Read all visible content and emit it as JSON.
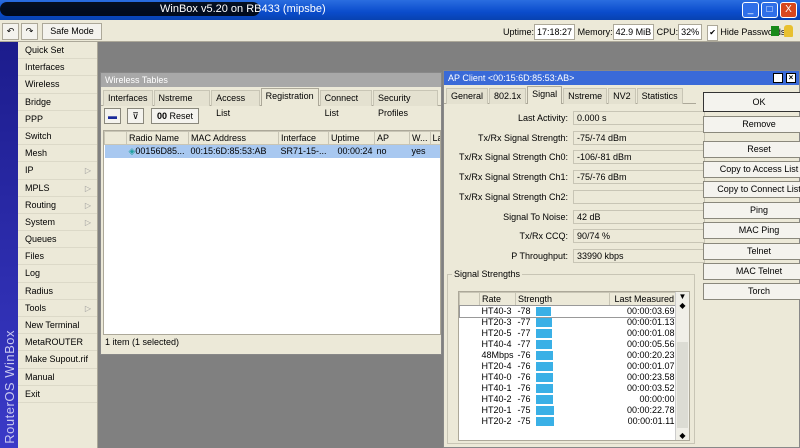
{
  "window": {
    "title": "WinBox v5.20 on RB433 (mipsbe)",
    "minimize": "_",
    "maximize": "□",
    "close": "X"
  },
  "toolbar": {
    "undo": "↶",
    "redo": "↷",
    "safe_mode": "Safe Mode",
    "uptime_label": "Uptime:",
    "uptime": "17:18:27",
    "memory_label": "Memory:",
    "memory": "42.9 MiB",
    "cpu_label": "CPU:",
    "cpu": "32%",
    "hide_passwords": "Hide Passwords",
    "hide_passwords_checked": true
  },
  "sidebar": {
    "brand": "RouterOS WinBox",
    "items": [
      {
        "label": "Quick Set"
      },
      {
        "label": "Interfaces"
      },
      {
        "label": "Wireless"
      },
      {
        "label": "Bridge"
      },
      {
        "label": "PPP"
      },
      {
        "label": "Switch"
      },
      {
        "label": "Mesh"
      },
      {
        "label": "IP",
        "submenu": true
      },
      {
        "label": "MPLS",
        "submenu": true
      },
      {
        "label": "Routing",
        "submenu": true
      },
      {
        "label": "System",
        "submenu": true
      },
      {
        "label": "Queues"
      },
      {
        "label": "Files"
      },
      {
        "label": "Log"
      },
      {
        "label": "Radius"
      },
      {
        "label": "Tools",
        "submenu": true
      },
      {
        "label": "New Terminal"
      },
      {
        "label": "MetaROUTER"
      },
      {
        "label": "Make Supout.rif"
      },
      {
        "label": "Manual"
      },
      {
        "label": "Exit"
      }
    ]
  },
  "wireless": {
    "title": "Wireless Tables",
    "tabs": [
      "Interfaces",
      "Nstreme Dual",
      "Access List",
      "Registration",
      "Connect List",
      "Security Profiles"
    ],
    "active_tab": "Registration",
    "reset": "Reset",
    "reset_icon": "00",
    "columns": [
      "Radio Name",
      "MAC Address",
      "Interface",
      "Uptime",
      "AP",
      "W...",
      "La"
    ],
    "rows": [
      {
        "radio_name": "00156D85...",
        "mac": "00:15:6D:85:53:AB",
        "interface": "SR71-15-...",
        "uptime": "00:00:24",
        "ap": "no",
        "w": "yes",
        "la": ""
      }
    ],
    "status": "1 item (1 selected)"
  },
  "ap_client": {
    "title": "AP Client <00:15:6D:85:53:AB>",
    "tabs": [
      "General",
      "802.1x",
      "Signal",
      "Nstreme",
      "NV2",
      "Statistics"
    ],
    "active_tab": "Signal",
    "fields": [
      {
        "label": "Last Activity:",
        "value": "0.000 s"
      },
      {
        "label": "Tx/Rx Signal Strength:",
        "value": "-75/-74 dBm"
      },
      {
        "label": "Tx/Rx Signal Strength Ch0:",
        "value": "-106/-81 dBm"
      },
      {
        "label": "Tx/Rx Signal Strength Ch1:",
        "value": "-75/-76 dBm"
      },
      {
        "label": "Tx/Rx Signal Strength Ch2:",
        "value": ""
      },
      {
        "label": "Signal To Noise:",
        "value": "42 dB"
      },
      {
        "label": "Tx/Rx CCQ:",
        "value": "90/74 %"
      },
      {
        "label": "P Throughput:",
        "value": "33990 kbps"
      }
    ],
    "buttons": [
      "OK",
      "Remove",
      "Reset",
      "Copy to Access List",
      "Copy to Connect List",
      "Ping",
      "MAC Ping",
      "Telnet",
      "MAC Telnet",
      "Torch"
    ],
    "signal_group": "Signal Strengths",
    "signal_columns": [
      "Rate",
      "Strength",
      "Last Measured"
    ],
    "signals": [
      {
        "rate": "HT40-3",
        "strength": "-78",
        "last": "00:00:03.69"
      },
      {
        "rate": "HT20-3",
        "strength": "-77",
        "last": "00:00:01.13"
      },
      {
        "rate": "HT20-5",
        "strength": "-77",
        "last": "00:00:01.08"
      },
      {
        "rate": "HT40-4",
        "strength": "-77",
        "last": "00:00:05.56"
      },
      {
        "rate": "48Mbps",
        "strength": "-76",
        "last": "00:00:20.23"
      },
      {
        "rate": "HT20-4",
        "strength": "-76",
        "last": "00:00:01.07"
      },
      {
        "rate": "HT40-0",
        "strength": "-76",
        "last": "00:00:23.58"
      },
      {
        "rate": "HT40-1",
        "strength": "-76",
        "last": "00:00:03.52"
      },
      {
        "rate": "HT40-2",
        "strength": "-76",
        "last": "00:00:00"
      },
      {
        "rate": "HT20-1",
        "strength": "-75",
        "last": "00:00:22.78"
      },
      {
        "rate": "HT20-2",
        "strength": "-75",
        "last": "00:00:01.11"
      }
    ]
  }
}
